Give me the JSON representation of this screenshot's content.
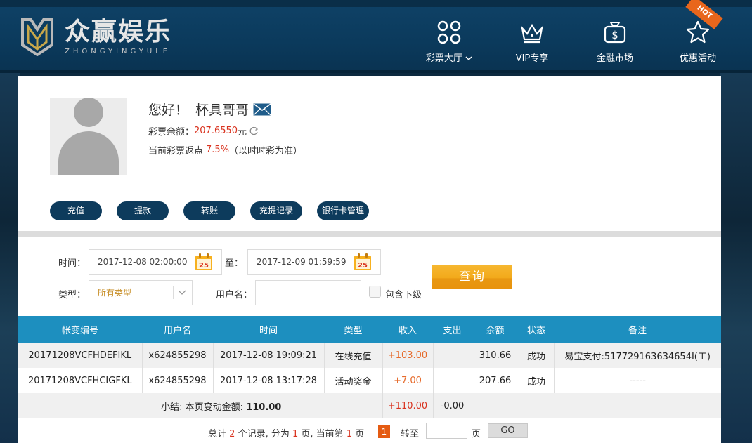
{
  "brand": {
    "title": "众赢娱乐",
    "subtitle": "ZHONGYINGYULE"
  },
  "nav": [
    {
      "label": "彩票大厅",
      "icon": "grid-icon"
    },
    {
      "label": "VIP专享",
      "icon": "crown-icon"
    },
    {
      "label": "金融市场",
      "icon": "money-bag-icon"
    },
    {
      "label": "优惠活动",
      "icon": "star-icon",
      "badge": "HOT"
    }
  ],
  "user": {
    "greeting": "您好！",
    "name": "杯具哥哥",
    "balance_label": "彩票余额：",
    "balance_value": "207.6550",
    "balance_unit": "元",
    "rebate_label": "当前彩票返点",
    "rebate_value": "7.5%",
    "rebate_note": "（以时时彩为准）"
  },
  "actions": [
    "充值",
    "提款",
    "转账",
    "充提记录",
    "银行卡管理"
  ],
  "filter": {
    "time_label": "时间：",
    "time_from": "2017-12-08 02:00:00",
    "to_label": "至：",
    "time_to": "2017-12-09 01:59:59",
    "calendar_day": "25",
    "type_label": "类型：",
    "type_value": "所有类型",
    "username_label": "用户名：",
    "username_value": "",
    "include_sub_label": "包含下级",
    "query_label": "查询"
  },
  "table": {
    "headers": [
      "帐变编号",
      "用户名",
      "时间",
      "类型",
      "收入",
      "支出",
      "余额",
      "状态",
      "备注"
    ],
    "rows": [
      [
        "20171208VCFHDEFIKL",
        "x624855298",
        "2017-12-08 19:09:21",
        "在线充值",
        "+103.00",
        "",
        "310.66",
        "成功",
        "易宝支付:517729163634654I(工)"
      ],
      [
        "20171208VCFHCIGFKL",
        "x624855298",
        "2017-12-08 13:17:28",
        "活动奖金",
        "+7.00",
        "",
        "207.66",
        "成功",
        "-----"
      ]
    ],
    "summary": {
      "label": "小结: 本页变动金额:",
      "amount": "110.00",
      "income": "+110.00",
      "expense": "-0.00"
    }
  },
  "pager": {
    "total_prefix": "总计",
    "total_count": "2",
    "records_text": "个记录, 分为",
    "pages": "1",
    "pages_text": "页, 当前第",
    "current": "1",
    "page_text": "页",
    "current_badge": "1",
    "goto_label": "转至",
    "goto_unit": "页",
    "go_label": "GO"
  },
  "colors": {
    "header_bg": "#0b3a5c",
    "table_header": "#1d8fbf",
    "query_button": "#f2a91a",
    "accent_red": "#d9331f",
    "income_orange": "#e66b2c"
  }
}
